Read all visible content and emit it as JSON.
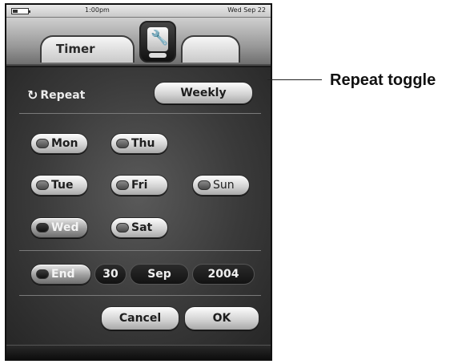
{
  "status_bar": {
    "time": "1:00pm",
    "date": "Wed Sep 22"
  },
  "tabs": {
    "active_label": "Timer"
  },
  "repeat": {
    "label": "Repeat",
    "toggle_value": "Weekly"
  },
  "days": [
    {
      "label": "Mon",
      "selected": false
    },
    {
      "label": "Tue",
      "selected": false
    },
    {
      "label": "Wed",
      "selected": true
    },
    {
      "label": "Thu",
      "selected": false
    },
    {
      "label": "Fri",
      "selected": false
    },
    {
      "label": "Sat",
      "selected": false
    },
    {
      "label": "Sun",
      "selected": false
    }
  ],
  "end": {
    "label": "End",
    "day": "30",
    "month": "Sep",
    "year": "2004"
  },
  "actions": {
    "cancel_label": "Cancel",
    "ok_label": "OK"
  },
  "callout": {
    "label": "Repeat toggle"
  },
  "icons": {
    "tab_icon": "wrench-icon",
    "repeat_icon": "repeat-arrows-icon",
    "battery_icon": "battery-icon"
  }
}
